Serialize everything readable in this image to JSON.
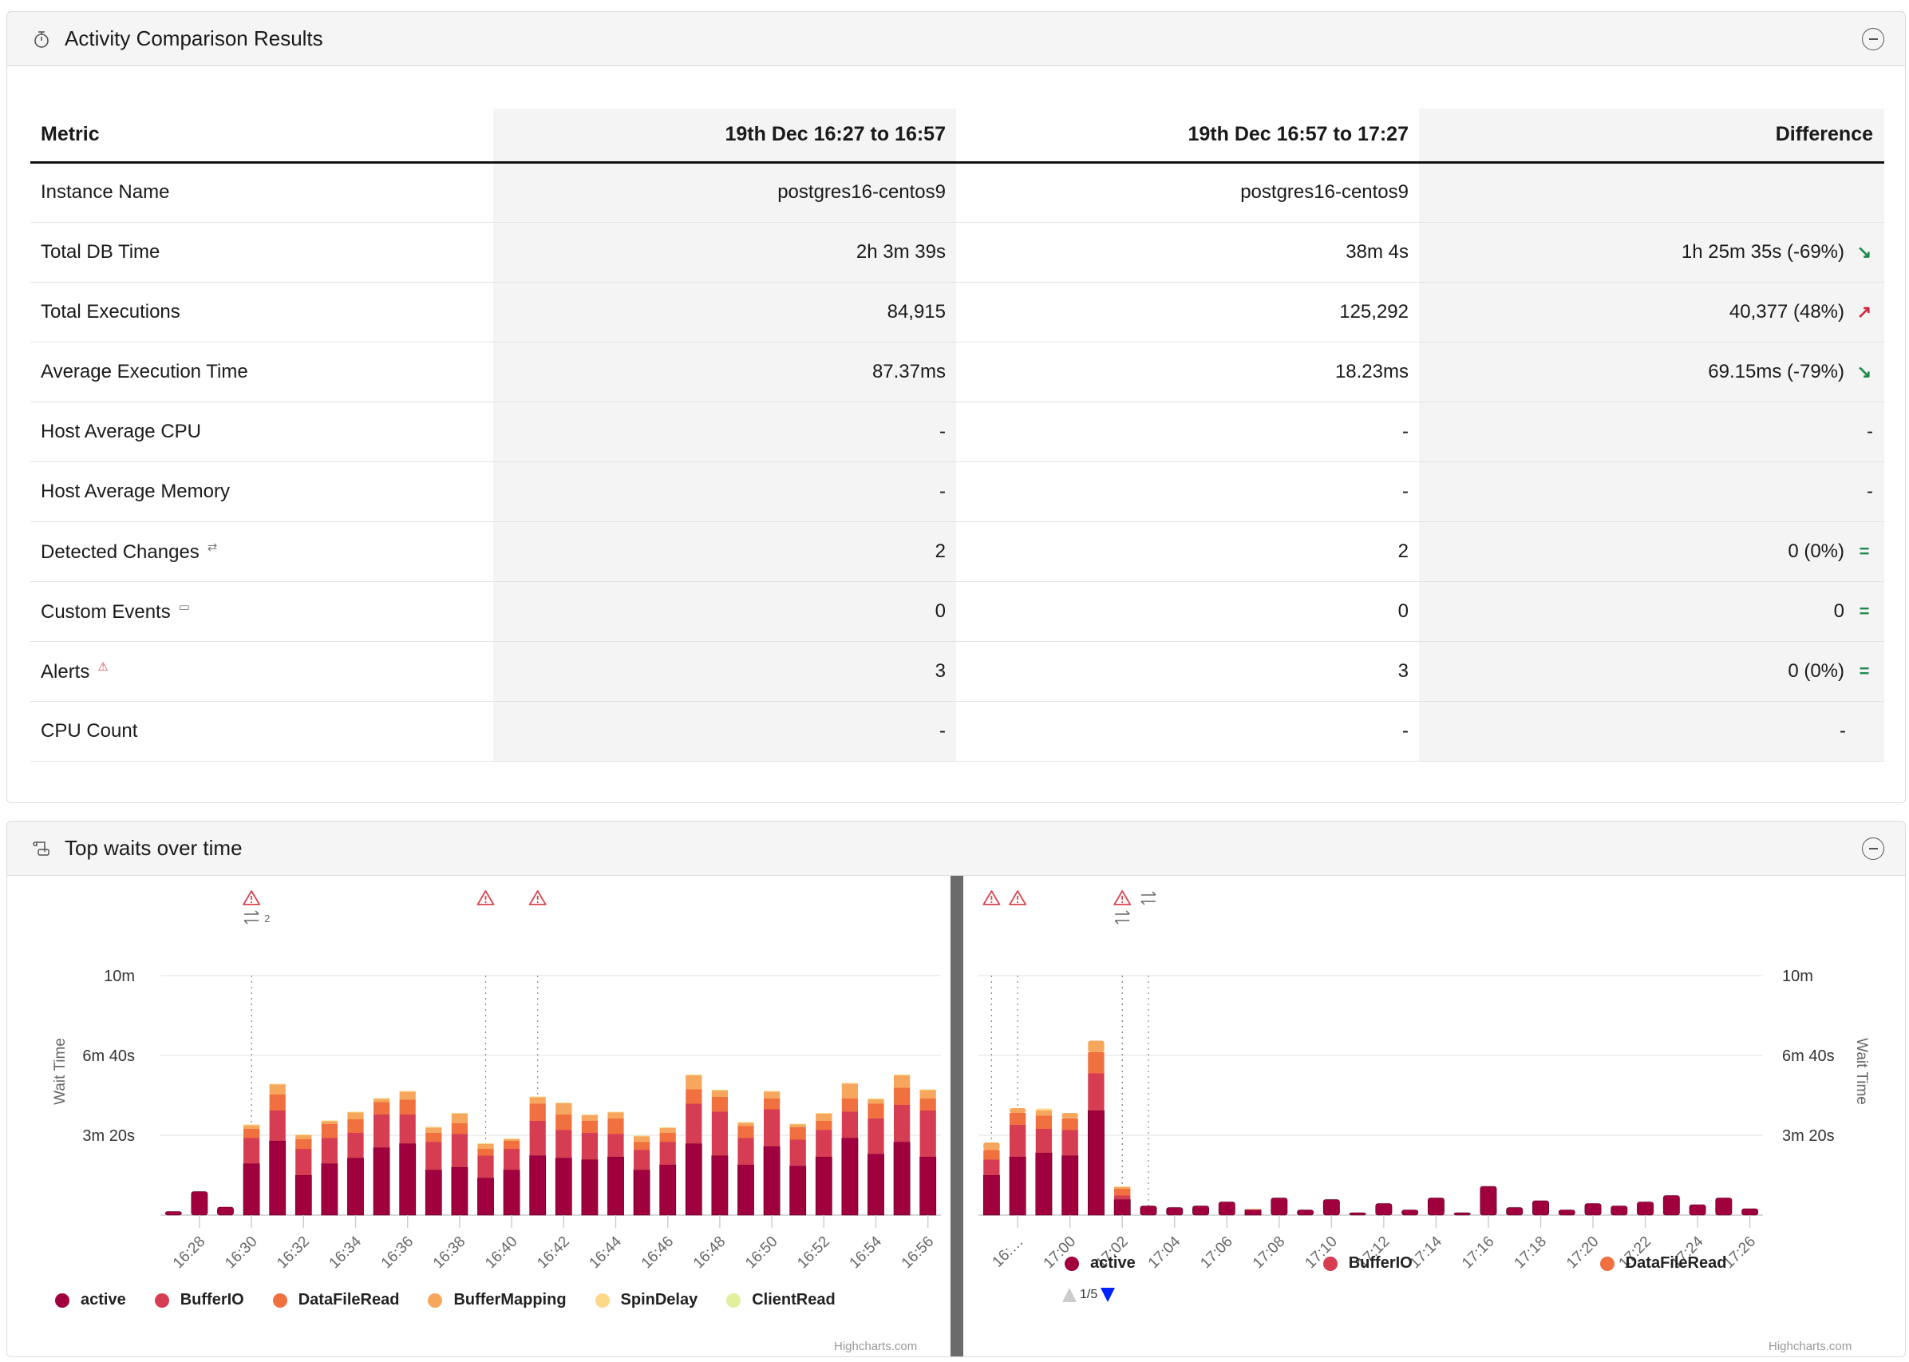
{
  "activity_panel": {
    "title": "Activity Comparison Results",
    "icon": "stopwatch-icon",
    "collapse_icon": "minus-circle-icon",
    "table": {
      "headers": [
        "Metric",
        "19th Dec 16:27 to 16:57",
        "19th Dec 16:57 to 17:27",
        "Difference"
      ],
      "rows": [
        {
          "metric": "Instance Name",
          "icon": null,
          "period1": "postgres16-centos9",
          "period2": "postgres16-centos9",
          "difference": "",
          "trend": null,
          "trend_glyph": ""
        },
        {
          "metric": "Total DB Time",
          "icon": null,
          "period1": "2h 3m 39s",
          "period2": "38m 4s",
          "difference": "1h 25m 35s (-69%)",
          "trend": "down",
          "trend_glyph": "↘"
        },
        {
          "metric": "Total Executions",
          "icon": null,
          "period1": "84,915",
          "period2": "125,292",
          "difference": "40,377 (48%)",
          "trend": "up",
          "trend_glyph": "↗"
        },
        {
          "metric": "Average Execution Time",
          "icon": null,
          "period1": "87.37ms",
          "period2": "18.23ms",
          "difference": "69.15ms (-79%)",
          "trend": "down",
          "trend_glyph": "↘"
        },
        {
          "metric": "Host Average CPU",
          "icon": null,
          "period1": "-",
          "period2": "-",
          "difference": "-",
          "trend": null,
          "trend_glyph": ""
        },
        {
          "metric": "Host Average Memory",
          "icon": null,
          "period1": "-",
          "period2": "-",
          "difference": "-",
          "trend": null,
          "trend_glyph": ""
        },
        {
          "metric": "Detected Changes",
          "icon": "swap-arrows-icon",
          "icon_glyph": "⇄",
          "period1": "2",
          "period2": "2",
          "difference": "0 (0%)",
          "trend": "eq",
          "trend_glyph": "="
        },
        {
          "metric": "Custom Events",
          "icon": "calendar-icon",
          "icon_glyph": "▭",
          "period1": "0",
          "period2": "0",
          "difference": "0",
          "trend": "eq",
          "trend_glyph": "="
        },
        {
          "metric": "Alerts",
          "icon": "warning-icon",
          "icon_glyph": "⚠",
          "period1": "3",
          "period2": "3",
          "difference": "0 (0%)",
          "trend": "eq",
          "trend_glyph": "="
        },
        {
          "metric": "CPU Count",
          "icon": null,
          "period1": "-",
          "period2": "-",
          "difference": "-",
          "trend": null,
          "trend_glyph": ""
        }
      ]
    },
    "colors": {
      "trend_down": "#1f8a4c",
      "trend_up": "#d0273e",
      "trend_eq": "#1f8a4c"
    }
  },
  "waits_panel": {
    "title": "Top waits over time",
    "icon": "scroll-icon",
    "collapse_icon": "minus-circle-icon",
    "credits": "Highcharts.com",
    "right_legend_pager": "1/5"
  },
  "chart_data": [
    {
      "type": "bar",
      "stacked": true,
      "title": "",
      "xlabel": "",
      "ylabel": "Wait Time",
      "y_unit": "seconds",
      "ylim": [
        0,
        600
      ],
      "yticks": [
        0,
        200,
        400,
        600
      ],
      "ytick_labels": [
        "",
        "3m 20s",
        "6m 40s",
        "10m"
      ],
      "grid": true,
      "y_axis_side": "left",
      "categories": [
        "16:27",
        "16:28",
        "16:29",
        "16:30",
        "16:31",
        "16:32",
        "16:33",
        "16:34",
        "16:35",
        "16:36",
        "16:37",
        "16:38",
        "16:39",
        "16:40",
        "16:41",
        "16:42",
        "16:43",
        "16:44",
        "16:45",
        "16:46",
        "16:47",
        "16:48",
        "16:49",
        "16:50",
        "16:51",
        "16:52",
        "16:53",
        "16:54",
        "16:55",
        "16:56"
      ],
      "xtick_labels": [
        "16:28",
        "16:30",
        "16:32",
        "16:34",
        "16:36",
        "16:38",
        "16:40",
        "16:42",
        "16:44",
        "16:46",
        "16:48",
        "16:50",
        "16:52",
        "16:54",
        "16:56"
      ],
      "series": [
        {
          "name": "active",
          "color": "#a1003f",
          "values": [
            9,
            59,
            20,
            129,
            186,
            100,
            129,
            143,
            169,
            179,
            113,
            120,
            93,
            113,
            149,
            143,
            139,
            146,
            113,
            126,
            179,
            149,
            126,
            172,
            123,
            146,
            193,
            153,
            183,
            146
          ]
        },
        {
          "name": "BufferIO",
          "color": "#d63c52",
          "values": [
            0,
            0,
            0,
            64,
            76,
            66,
            64,
            63,
            83,
            73,
            70,
            83,
            56,
            53,
            87,
            70,
            67,
            57,
            50,
            57,
            100,
            110,
            67,
            93,
            66,
            67,
            66,
            89,
            93,
            116
          ]
        },
        {
          "name": "DataFileRead",
          "color": "#f07040",
          "values": [
            0,
            0,
            0,
            23,
            40,
            24,
            35,
            34,
            31,
            37,
            23,
            27,
            17,
            20,
            43,
            39,
            30,
            39,
            20,
            23,
            36,
            37,
            30,
            27,
            31,
            23,
            33,
            37,
            43,
            30
          ]
        },
        {
          "name": "BufferMapping",
          "color": "#f7a65d",
          "values": [
            0,
            0,
            0,
            10,
            26,
            11,
            8,
            18,
            9,
            21,
            14,
            25,
            13,
            5,
            17,
            29,
            15,
            16,
            15,
            13,
            36,
            17,
            9,
            18,
            8,
            19,
            38,
            12,
            32,
            22
          ]
        },
        {
          "name": "SpinDelay",
          "color": "#fbd98a",
          "values": [
            0,
            0,
            0,
            1,
            1,
            1,
            1,
            1,
            1,
            1,
            1,
            1,
            1,
            1,
            1,
            1,
            1,
            1,
            1,
            1,
            1,
            1,
            1,
            1,
            1,
            1,
            1,
            1,
            1,
            1
          ]
        },
        {
          "name": "ClientRead",
          "color": "#e3ef9c",
          "values": [
            0,
            0,
            0,
            0,
            0,
            0,
            0,
            0,
            0,
            0,
            0,
            0,
            0,
            0,
            0,
            0,
            0,
            0,
            0,
            0,
            0,
            0,
            0,
            0,
            0,
            0,
            0,
            0,
            0,
            0
          ]
        }
      ],
      "legend": [
        "active",
        "BufferIO",
        "DataFileRead",
        "BufferMapping",
        "SpinDelay",
        "ClientRead"
      ],
      "legend_position": "bottom",
      "annotations": [
        {
          "x": "16:30",
          "type": "alert",
          "icon": "warning-icon"
        },
        {
          "x": "16:30",
          "type": "change",
          "icon": "swap-arrows-icon",
          "count": "2"
        },
        {
          "x": "16:39",
          "type": "alert",
          "icon": "warning-icon"
        },
        {
          "x": "16:41",
          "type": "alert",
          "icon": "warning-icon"
        }
      ]
    },
    {
      "type": "bar",
      "stacked": true,
      "title": "",
      "xlabel": "",
      "ylabel": "Wait Time",
      "y_unit": "seconds",
      "ylim": [
        0,
        600
      ],
      "yticks": [
        0,
        200,
        400,
        600
      ],
      "ytick_labels": [
        "",
        "3m 20s",
        "6m 40s",
        "10m"
      ],
      "grid": true,
      "y_axis_side": "right",
      "categories": [
        "16:57",
        "16:58",
        "16:59",
        "17:00",
        "17:01",
        "17:02",
        "17:03",
        "17:04",
        "17:05",
        "17:06",
        "17:07",
        "17:08",
        "17:09",
        "17:10",
        "17:11",
        "17:12",
        "17:13",
        "17:14",
        "17:15",
        "17:16",
        "17:17",
        "17:18",
        "17:19",
        "17:20",
        "17:21",
        "17:22",
        "17:23",
        "17:24",
        "17:25",
        "17:26"
      ],
      "xtick_labels": [
        "16:…",
        "17:00",
        "17:02",
        "17:04",
        "17:06",
        "17:08",
        "17:10",
        "17:12",
        "17:14",
        "17:16",
        "17:18",
        "17:20",
        "17:22",
        "17:24",
        "17:26"
      ],
      "series": [
        {
          "name": "active",
          "color": "#a1003f",
          "values": [
            100,
            146,
            156,
            149,
            262,
            39,
            23,
            19,
            23,
            33,
            13,
            43,
            13,
            39,
            6,
            29,
            13,
            43,
            6,
            72,
            19,
            36,
            13,
            29,
            23,
            33,
            49,
            26,
            43,
            16
          ]
        },
        {
          "name": "BufferIO",
          "color": "#d63c52",
          "values": [
            39,
            80,
            60,
            64,
            93,
            10,
            0,
            0,
            0,
            0,
            0,
            0,
            0,
            0,
            0,
            0,
            0,
            0,
            0,
            0,
            0,
            0,
            0,
            0,
            0,
            0,
            0,
            0,
            0,
            0
          ]
        },
        {
          "name": "DataFileRead",
          "color": "#f07040",
          "values": [
            24,
            30,
            33,
            29,
            53,
            17,
            0,
            0,
            0,
            0,
            2,
            0,
            0,
            0,
            0,
            0,
            0,
            0,
            0,
            0,
            0,
            0,
            0,
            0,
            0,
            0,
            0,
            0,
            0,
            0
          ]
        },
        {
          "name": "BufferMapping",
          "color": "#f7a65d",
          "values": [
            19,
            12,
            13,
            14,
            29,
            5,
            0,
            0,
            0,
            0,
            0,
            0,
            0,
            0,
            0,
            0,
            0,
            0,
            0,
            0,
            0,
            0,
            0,
            0,
            0,
            0,
            0,
            0,
            0,
            0
          ]
        },
        {
          "name": "SpinDelay",
          "color": "#fbd98a",
          "values": [
            0,
            0,
            5,
            0,
            0,
            1,
            0,
            0,
            0,
            0,
            0,
            0,
            0,
            0,
            0,
            0,
            0,
            0,
            0,
            0,
            0,
            0,
            0,
            0,
            0,
            0,
            0,
            0,
            0,
            0
          ]
        }
      ],
      "legend": [
        "active",
        "BufferIO",
        "DataFileRead"
      ],
      "legend_position": "bottom",
      "annotations": [
        {
          "x": "16:57",
          "type": "alert",
          "icon": "warning-icon"
        },
        {
          "x": "16:58",
          "type": "alert",
          "icon": "warning-icon"
        },
        {
          "x": "17:02",
          "type": "alert",
          "icon": "warning-icon"
        },
        {
          "x": "17:02",
          "type": "change",
          "icon": "swap-arrows-icon"
        },
        {
          "x": "17:03",
          "type": "change",
          "icon": "swap-arrows-icon"
        }
      ]
    }
  ]
}
